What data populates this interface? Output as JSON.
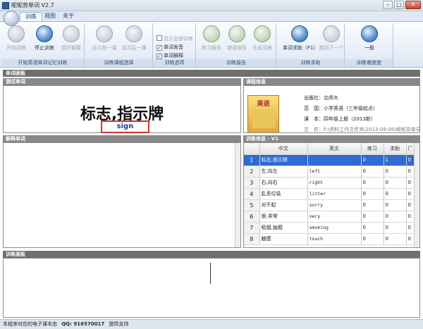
{
  "window": {
    "title": "呢呢背单词 V2.7",
    "minimize": "–",
    "maximize": "□",
    "close": "✕"
  },
  "tabs": [
    "训练",
    "视图",
    "关于"
  ],
  "ribbon": {
    "group1": {
      "label": "开始英语单词记忆训练",
      "buttons": [
        "开始训练",
        "停止训练",
        "暂时搁置"
      ]
    },
    "group2": {
      "label": "训练课程选择",
      "buttons": [
        "显示前一课",
        "显示后一课"
      ]
    },
    "group3": {
      "label": "训练选项",
      "checks": [
        {
          "label": "显示全部训练",
          "checked": false
        },
        {
          "label": "单词发音",
          "checked": true
        },
        {
          "label": "单词解释",
          "checked": true
        }
      ]
    },
    "group4": {
      "label": "训练报告",
      "buttons": [
        "练习报告",
        "错误报告",
        "生成词表"
      ]
    },
    "group5": {
      "label": "训练求助",
      "buttons": [
        "单词求助（F1）",
        "跳到下一个"
      ]
    },
    "group6": {
      "label": "训练难度度",
      "buttons": [
        "一般"
      ]
    }
  },
  "panels": {
    "word_panel": "单词面板",
    "test_word": "测试单词",
    "course_info": "课程信息",
    "explain_word": "解释单词",
    "training_info": "训练信息 - V1",
    "training_panel": "训练面板"
  },
  "test": {
    "chinese": "标志,指示牌",
    "answer": "sign"
  },
  "course": {
    "cover_title": "英语",
    "publisher": "出版社：北师大",
    "scope": "范　围：小学英语（三年级起点）",
    "lesson": "课　本：四年级上册（2013新）",
    "file": "文　件：F:\\资料工作文件夹\\2013-09-05\\呢呢背单词.wxn"
  },
  "table": {
    "headers": [
      "",
      "中文",
      "英文",
      "练习",
      "求助",
      "厂"
    ],
    "rows": [
      {
        "n": "1",
        "cn": "标志,指示牌",
        "en": "",
        "p": "0",
        "h": "1",
        "x": "0",
        "selected": true
      },
      {
        "n": "2",
        "cn": "左,向左",
        "en": "left",
        "p": "0",
        "h": "0",
        "x": "0"
      },
      {
        "n": "3",
        "cn": "右,向右",
        "en": "right",
        "p": "0",
        "h": "0",
        "x": "0"
      },
      {
        "n": "4",
        "cn": "乱丢垃圾",
        "en": "litter",
        "p": "0",
        "h": "0",
        "x": "0"
      },
      {
        "n": "5",
        "cn": "对不起",
        "en": "sorry",
        "p": "0",
        "h": "0",
        "x": "0"
      },
      {
        "n": "6",
        "cn": "很,非常",
        "en": "very",
        "p": "0",
        "h": "0",
        "x": "0"
      },
      {
        "n": "7",
        "cn": "吸烟,抽烟",
        "en": "smoking",
        "p": "0",
        "h": "0",
        "x": "0"
      },
      {
        "n": "8",
        "cn": "触摸",
        "en": "touch",
        "p": "0",
        "h": "0",
        "x": "0"
      }
    ]
  },
  "status": {
    "text": "本程序对应的电子课本由",
    "qq": "QQ:  916570017",
    "support": "提供支持"
  }
}
